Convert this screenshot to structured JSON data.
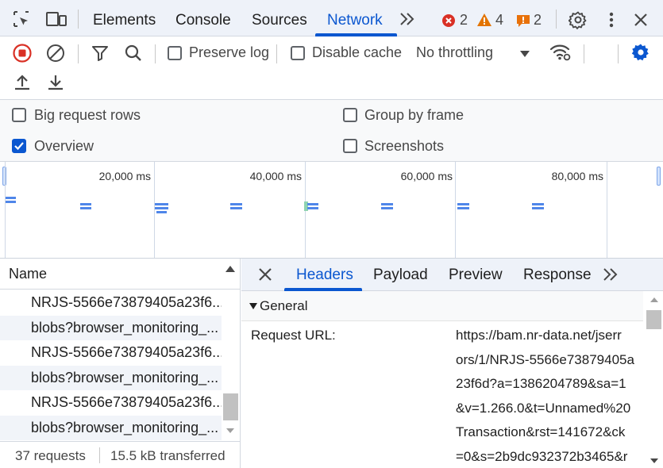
{
  "tabbar": {
    "tabs": [
      {
        "label": "Elements"
      },
      {
        "label": "Console"
      },
      {
        "label": "Sources"
      },
      {
        "label": "Network"
      }
    ],
    "errors": "2",
    "warnings": "4",
    "issues": "2"
  },
  "toolbar": {
    "preserve_log": "Preserve log",
    "disable_cache": "Disable cache",
    "throttling": "No throttling"
  },
  "settings": {
    "big_rows": "Big request rows",
    "group_by_frame": "Group by frame",
    "overview": "Overview",
    "screenshots": "Screenshots",
    "overview_checked": true
  },
  "overview": {
    "ticks": [
      "20,000 ms",
      "40,000 ms",
      "60,000 ms",
      "80,000 ms"
    ]
  },
  "requests": {
    "header": "Name",
    "rows": [
      "NRJS-5566e73879405a23f6...",
      "blobs?browser_monitoring_...",
      "NRJS-5566e73879405a23f6...",
      "blobs?browser_monitoring_...",
      "NRJS-5566e73879405a23f6...",
      "blobs?browser_monitoring_..."
    ],
    "count": "37 requests",
    "transferred": "15.5 kB transferred"
  },
  "details": {
    "tabs": [
      "Headers",
      "Payload",
      "Preview",
      "Response"
    ],
    "section": "General",
    "request_url_label": "Request URL:",
    "request_url_lines": [
      "https://bam.nr-data.net/jserr",
      "ors/1/NRJS-5566e73879405a",
      "23f6d?a=1386204789&sa=1",
      "&v=1.266.0&t=Unnamed%20",
      "Transaction&rst=141672&ck",
      "=0&s=2b9dc932372b3465&r"
    ]
  },
  "colors": {
    "accent": "#0b57d0",
    "error": "#d93025",
    "warning": "#e37400",
    "record": "#d93025"
  }
}
